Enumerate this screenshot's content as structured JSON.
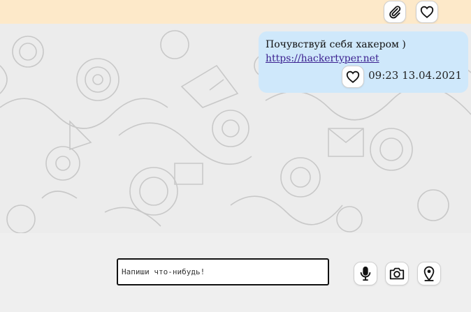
{
  "toolbar": {
    "attach_icon": "paperclip-icon",
    "like_icon": "heart-icon"
  },
  "message": {
    "text": "Почувствуй себя хакером )",
    "link": "https://hackertyper.net",
    "time": "09:23 13.04.2021",
    "like_icon": "heart-icon"
  },
  "composer": {
    "placeholder": "Напиши что-нибудь!",
    "value": "",
    "mic_icon": "microphone-icon",
    "camera_icon": "camera-icon",
    "location_icon": "location-pin-icon"
  },
  "colors": {
    "topbar": "#fde9c9",
    "bubble": "#cfe8fb",
    "chat_background": "#ececec",
    "bottom_panel": "#efefef"
  }
}
